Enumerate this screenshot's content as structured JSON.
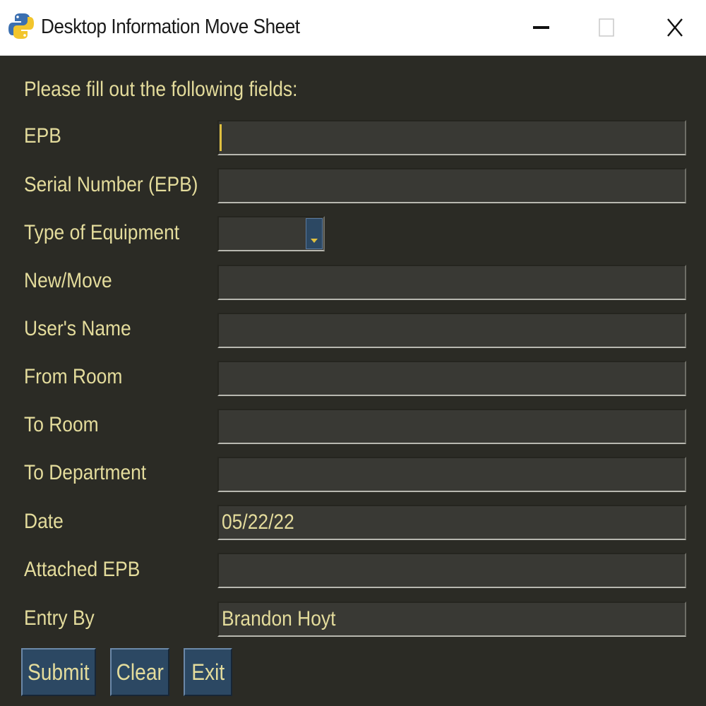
{
  "window": {
    "title": "Desktop Information Move Sheet",
    "app_icon": "python-icon",
    "controls": {
      "minimize": "minimize-icon",
      "maximize": "maximize-icon",
      "close": "close-icon"
    }
  },
  "form": {
    "instructions": "Please fill out the following fields:",
    "fields": [
      {
        "label": "EPB",
        "value": ""
      },
      {
        "label": "Serial Number (EPB)",
        "value": ""
      },
      {
        "label": "Type of Equipment",
        "value": ""
      },
      {
        "label": "New/Move",
        "value": ""
      },
      {
        "label": "User's Name",
        "value": ""
      },
      {
        "label": "From Room",
        "value": ""
      },
      {
        "label": "To Room",
        "value": ""
      },
      {
        "label": "To Department",
        "value": ""
      },
      {
        "label": "Date",
        "value": "05/22/22"
      },
      {
        "label": "Attached EPB",
        "value": ""
      },
      {
        "label": "Entry By",
        "value": "Brandon Hoyt"
      }
    ]
  },
  "buttons": {
    "submit": "Submit",
    "clear": "Clear",
    "exit": "Exit"
  },
  "colors": {
    "background": "#2b2b25",
    "text": "#e4dc9c",
    "field": "#393934",
    "button": "#2c4863",
    "caret": "#e0c040"
  }
}
